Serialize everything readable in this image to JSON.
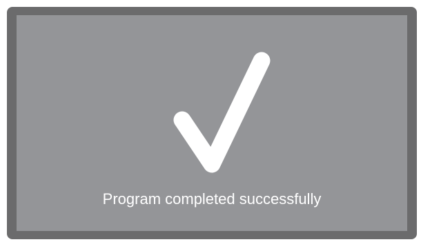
{
  "screen": {
    "icon": "checkmark-icon",
    "message": "Program completed successfully",
    "colors": {
      "frame": "#6b6b6c",
      "screen_background": "#949598",
      "foreground": "#ffffff"
    }
  }
}
